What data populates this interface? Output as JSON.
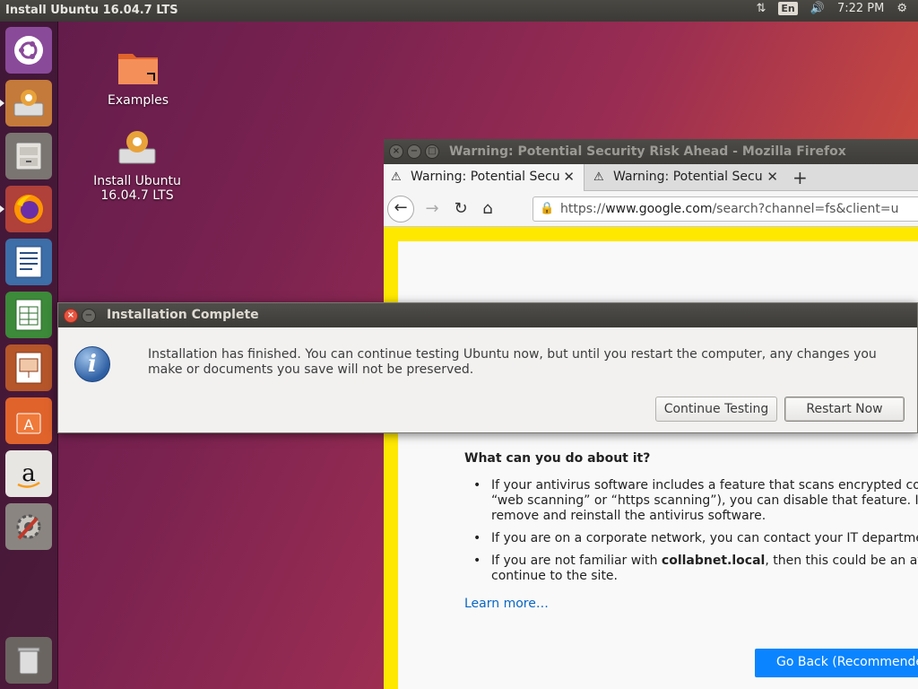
{
  "topbar": {
    "title": "Install Ubuntu 16.04.7 LTS",
    "lang": "En",
    "time": "7:22 PM"
  },
  "launcher": {
    "items": [
      "ubuntu-dash",
      "ubiquity-installer",
      "files",
      "firefox",
      "libreoffice-writer",
      "libreoffice-calc",
      "libreoffice-impress",
      "ubuntu-software",
      "amazon",
      "system-settings",
      "trash"
    ]
  },
  "desktop": {
    "icons": [
      {
        "label": "Examples"
      },
      {
        "label": "Install Ubuntu\n16.04.7 LTS"
      }
    ]
  },
  "firefox": {
    "window_title": "Warning: Potential Security Risk Ahead - Mozilla Firefox",
    "tabs": [
      {
        "label": "Warning: Potential Secu"
      },
      {
        "label": "Warning: Potential Secu"
      }
    ],
    "url_prefix": "https://",
    "url_host": "www.google.com",
    "url_rest": "/search?channel=fs&client=u",
    "heading": "What can you do about it?",
    "bullets": [
      "If your antivirus software includes a feature that scans encrypted conn",
      "“web scanning” or “https scanning”), you can disable that feature. If th",
      "remove and reinstall the antivirus software.",
      "If you are on a corporate network, you can contact your IT department",
      "If you are not familiar with ",
      "collabnet.local",
      ", then this could be an attac",
      "continue to the site."
    ],
    "learn_more": "Learn more…",
    "go_back": "Go Back (Recommended)"
  },
  "dialog": {
    "title": "Installation Complete",
    "message": "Installation has finished.  You can continue testing Ubuntu now, but until you restart the computer, any changes you make or documents you save will not be preserved.",
    "continue_label": "Continue Testing",
    "restart_label": "Restart Now"
  }
}
